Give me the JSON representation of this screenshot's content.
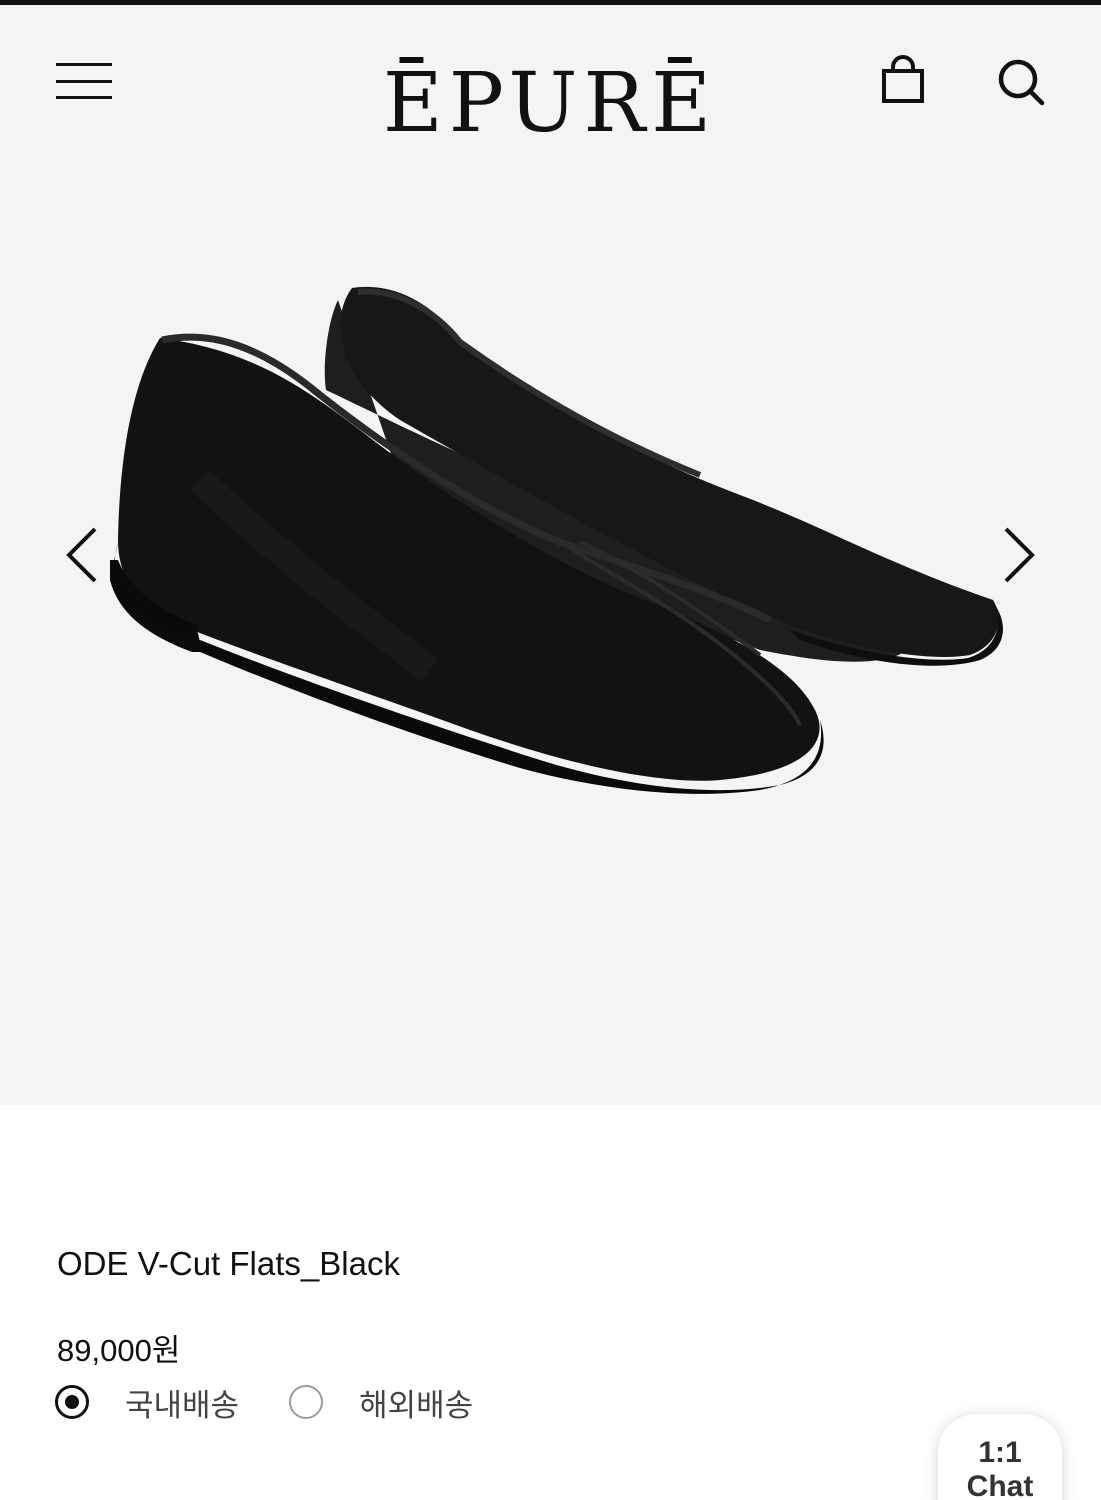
{
  "header": {
    "logo": "ĒPURĒ",
    "menu_icon": "hamburger-menu-icon",
    "cart_icon": "shopping-bag-icon",
    "search_icon": "search-icon"
  },
  "gallery": {
    "prev_icon": "chevron-left-icon",
    "next_icon": "chevron-right-icon",
    "image_subject": "black leather v-cut flat shoes"
  },
  "product": {
    "title": "ODE V-Cut Flats_Black",
    "price": "89,000원"
  },
  "shipping": {
    "options": [
      {
        "label": "국내배송",
        "selected": true
      },
      {
        "label": "해외배송",
        "selected": false
      }
    ]
  },
  "chat": {
    "line1": "1:1",
    "line2": "Chat"
  },
  "colors": {
    "hero_background": "#f4f4f4",
    "text": "#111111"
  }
}
